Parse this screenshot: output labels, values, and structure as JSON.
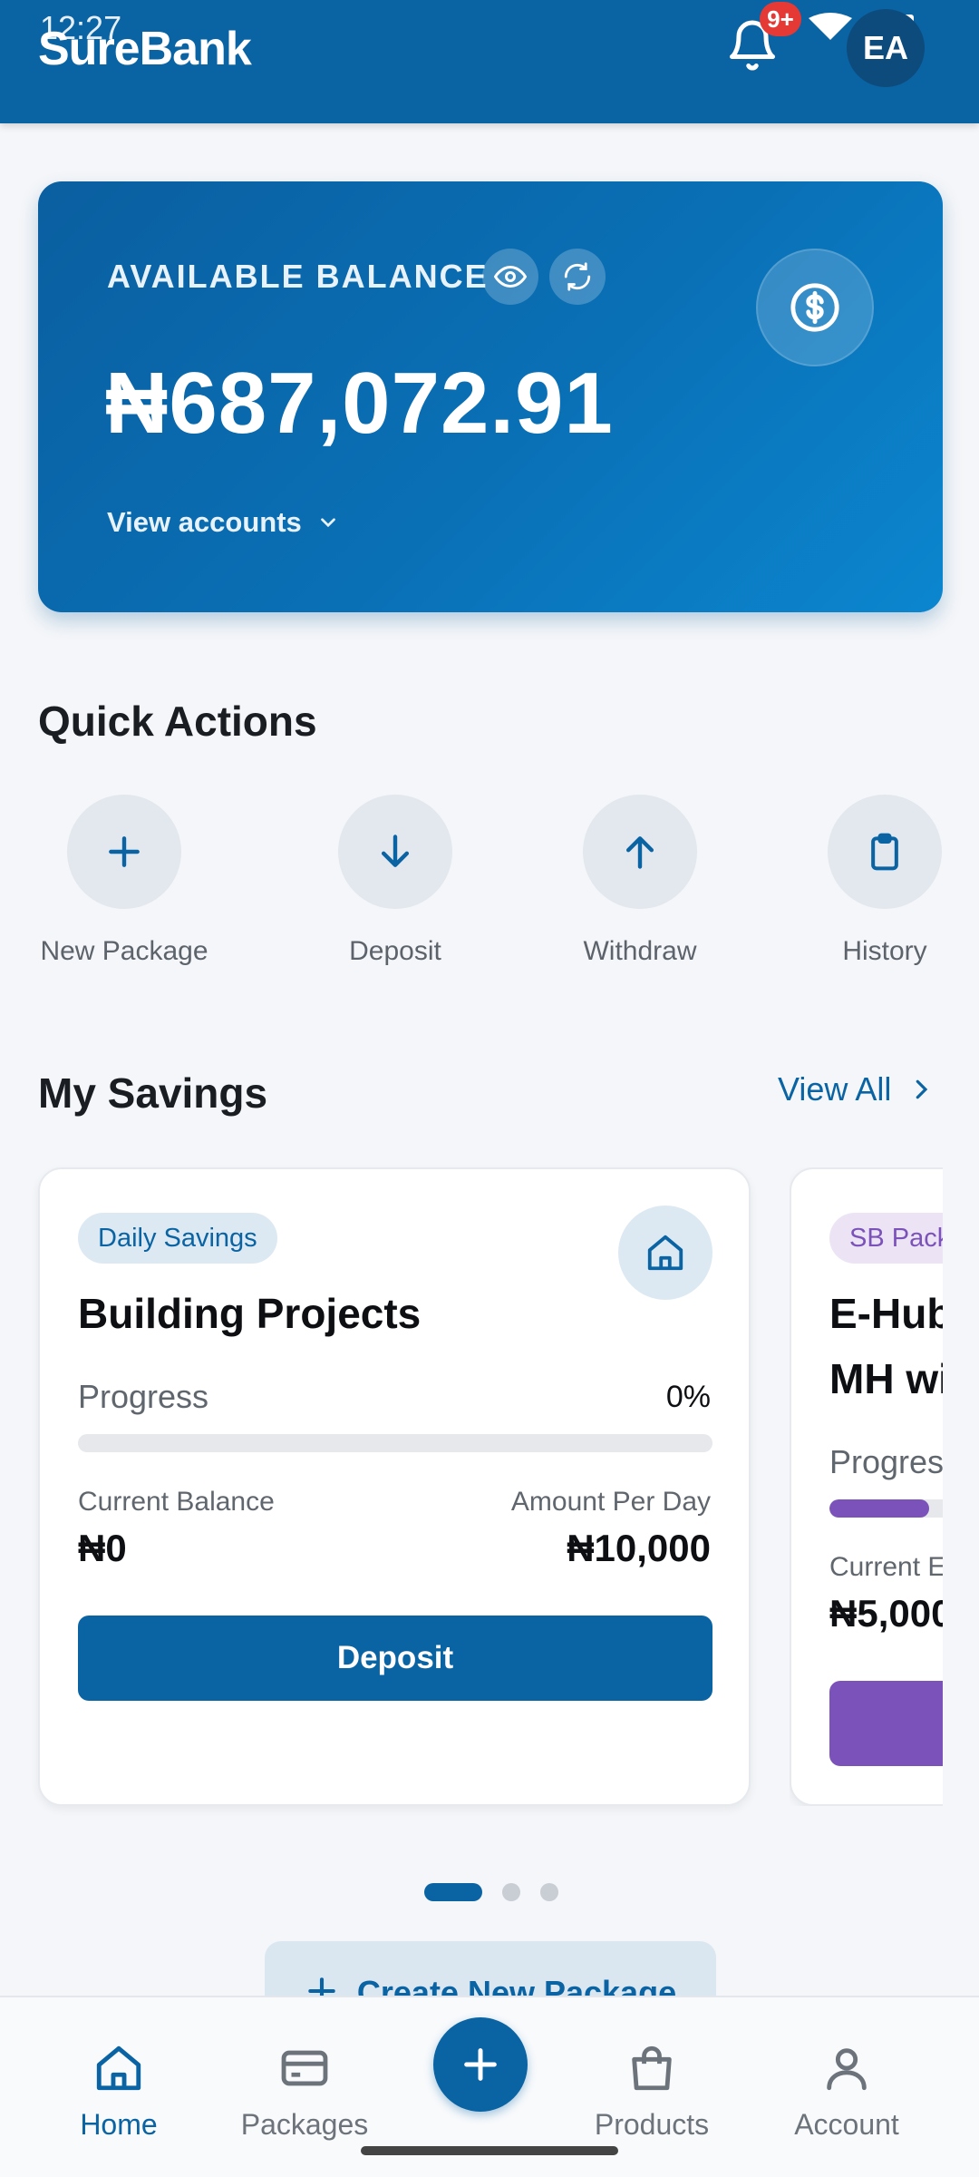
{
  "status_bar": {
    "time": "12:27"
  },
  "header": {
    "brand": "SureBank",
    "notification_badge": "9+",
    "avatar_initials": "EA"
  },
  "balance": {
    "label": "AVAILABLE BALANCE",
    "amount": "₦687,072.91",
    "view_accounts": "View accounts"
  },
  "quick_actions": {
    "title": "Quick Actions",
    "items": [
      {
        "label": "New Package",
        "icon": "plus-icon"
      },
      {
        "label": "Deposit",
        "icon": "arrow-down-icon"
      },
      {
        "label": "Withdraw",
        "icon": "arrow-up-icon"
      },
      {
        "label": "History",
        "icon": "clipboard-icon"
      }
    ]
  },
  "savings": {
    "title": "My Savings",
    "view_all": "View All",
    "cards": [
      {
        "tag": "Daily Savings",
        "title": "Building Projects",
        "progress_label": "Progress",
        "progress_value": "0%",
        "progress_fraction": 0,
        "balance_label": "Current Balance",
        "balance": "₦0",
        "amount_label": "Amount Per Day",
        "amount": "₦10,000",
        "button": "Deposit",
        "accent": "#0a63a3"
      },
      {
        "tag": "SB Pack",
        "title_line1": "E-Hub",
        "title_line2": "MH wi",
        "progress_label": "Progres",
        "balance_label": "Current E",
        "balance": "₦5,000",
        "accent": "#7b52b9"
      }
    ]
  },
  "create_package": "Create New Package",
  "bottom_nav": {
    "items": [
      {
        "label": "Home",
        "active": true
      },
      {
        "label": "Packages"
      },
      {
        "label": "Products"
      },
      {
        "label": "Account"
      }
    ]
  },
  "colors": {
    "primary": "#0a63a3",
    "purple": "#7b52b9",
    "badge": "#e53935"
  }
}
